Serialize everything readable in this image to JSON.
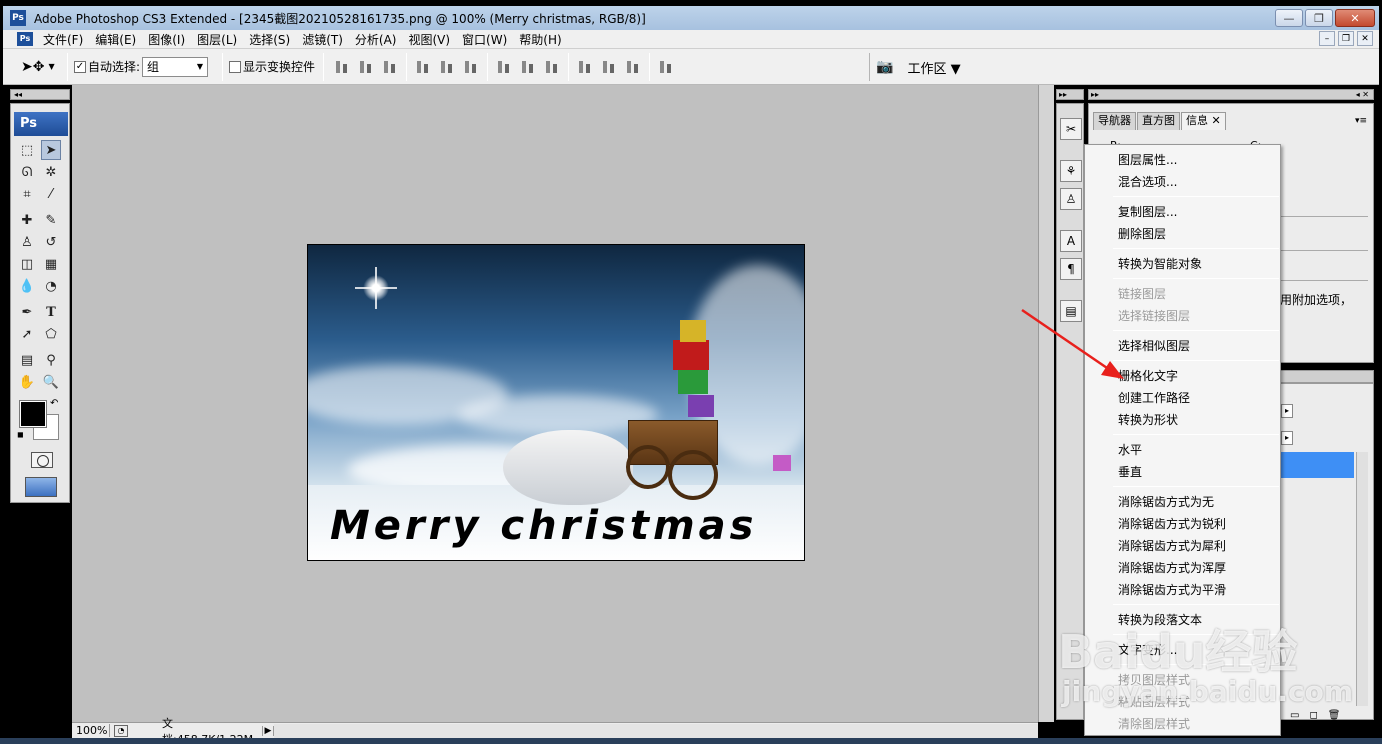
{
  "window": {
    "title": "Adobe Photoshop CS3 Extended - [2345截图20210528161735.png @ 100% (Merry christmas, RGB/8)]",
    "app_icon": "Ps",
    "controls": [
      "minimize-icon",
      "restore-icon",
      "close-icon"
    ]
  },
  "menubar": {
    "items": [
      "文件(F)",
      "编辑(E)",
      "图像(I)",
      "图层(L)",
      "选择(S)",
      "滤镜(T)",
      "分析(A)",
      "视图(V)",
      "窗口(W)",
      "帮助(H)"
    ]
  },
  "options": {
    "auto_select_label": "自动选择:",
    "auto_select_value": "组",
    "show_transform_label": "显示变换控件",
    "workspace_label": "工作区"
  },
  "toolbox": {
    "logo": "Ps",
    "text_tool_glyph": "T"
  },
  "document": {
    "caption": "Merry christmas"
  },
  "status": {
    "zoom": "100%",
    "doc_size": "文档:458.7K/1.22M"
  },
  "panel": {
    "tabs": [
      "导航器",
      "直方图",
      "信息"
    ],
    "info_r": "R:",
    "info_c": "C:",
    "hint": "用附加选项，"
  },
  "context_menu": {
    "items": [
      {
        "label": "图层属性...",
        "disabled": false
      },
      {
        "label": "混合选项...",
        "disabled": false
      },
      {
        "label": "复制图层...",
        "disabled": false
      },
      {
        "label": "删除图层",
        "disabled": false
      },
      {
        "label": "转换为智能对象",
        "disabled": false
      },
      {
        "label": "链接图层",
        "disabled": true
      },
      {
        "label": "选择链接图层",
        "disabled": true
      },
      {
        "label": "选择相似图层",
        "disabled": false
      },
      {
        "label": "栅格化文字",
        "disabled": false
      },
      {
        "label": "创建工作路径",
        "disabled": false
      },
      {
        "label": "转换为形状",
        "disabled": false
      },
      {
        "label": "水平",
        "disabled": false
      },
      {
        "label": "垂直",
        "disabled": false
      },
      {
        "label": "消除锯齿方式为无",
        "disabled": false
      },
      {
        "label": "消除锯齿方式为锐利",
        "disabled": false
      },
      {
        "label": "消除锯齿方式为犀利",
        "disabled": false
      },
      {
        "label": "消除锯齿方式为浑厚",
        "disabled": false
      },
      {
        "label": "消除锯齿方式为平滑",
        "disabled": false
      },
      {
        "label": "转换为段落文本",
        "disabled": false
      },
      {
        "label": "文字变形...",
        "disabled": false
      },
      {
        "label": "拷贝图层样式",
        "disabled": true
      },
      {
        "label": "粘贴图层样式",
        "disabled": true
      },
      {
        "label": "清除图层样式",
        "disabled": true
      }
    ]
  },
  "watermark": {
    "main": "Baidu经验",
    "sub": "jingyan.baidu.com"
  },
  "colors": {
    "annotation_arrow": "#e8201c",
    "layer_selection": "#3e8ff5"
  }
}
